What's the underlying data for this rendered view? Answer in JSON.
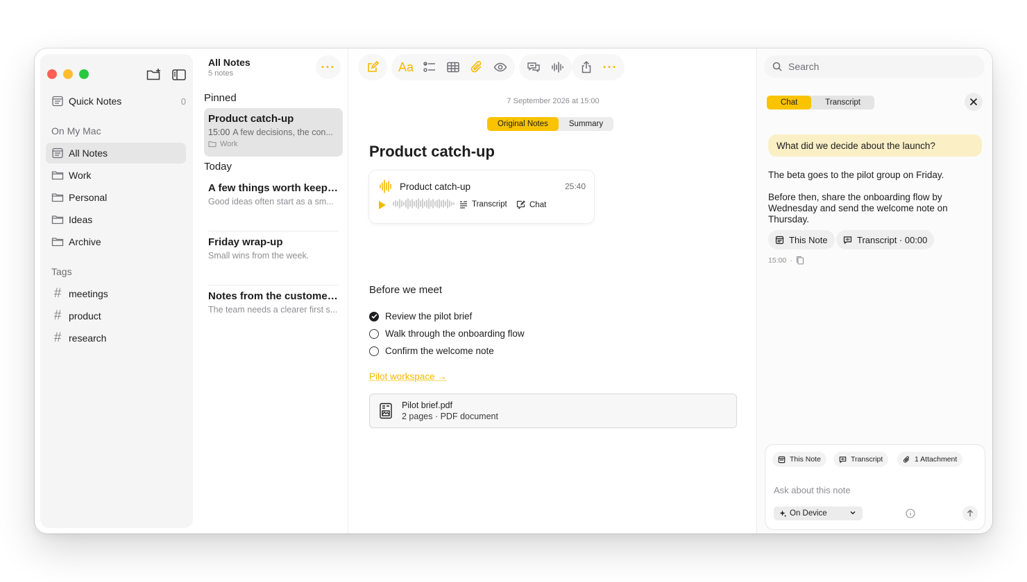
{
  "sidebar": {
    "quick_notes": {
      "label": "Quick Notes",
      "count": "0"
    },
    "section_on_my_mac": "On My Mac",
    "folders": [
      {
        "label": "All Notes",
        "icon": "notes-icon",
        "active": true
      },
      {
        "label": "Work",
        "icon": "folder-icon"
      },
      {
        "label": "Personal",
        "icon": "folder-icon"
      },
      {
        "label": "Ideas",
        "icon": "folder-icon"
      },
      {
        "label": "Archive",
        "icon": "folder-icon"
      }
    ],
    "section_tags": "Tags",
    "tags": [
      "meetings",
      "product",
      "research"
    ]
  },
  "list": {
    "title": "All Notes",
    "subtitle": "5 notes",
    "pinned_label": "Pinned",
    "today_label": "Today",
    "pinned": {
      "title": "Product catch-up",
      "time": "15:00",
      "preview": "A few decisions, the con...",
      "folder": "Work"
    },
    "today": [
      {
        "title": "A few things worth keepi...",
        "preview": "Good ideas often start as a sm..."
      },
      {
        "title": "Friday wrap-up",
        "preview": "Small wins from the week."
      },
      {
        "title": "Notes from the customer...",
        "preview": "The team needs a clearer first s..."
      }
    ]
  },
  "editor": {
    "date": "7 September 2026 at 15:00",
    "segments": [
      "Original Notes",
      "Summary"
    ],
    "title": "Product catch-up",
    "audio": {
      "title": "Product catch-up",
      "duration": "25:40",
      "transcript_label": "Transcript",
      "chat_label": "Chat"
    },
    "section": "Before we meet",
    "checklist": [
      {
        "text": "Review the pilot brief",
        "done": true
      },
      {
        "text": "Walk through the onboarding flow",
        "done": false
      },
      {
        "text": "Confirm the welcome note",
        "done": false
      }
    ],
    "link": "Pilot workspace →",
    "attachment": {
      "name": "Pilot brief.pdf",
      "meta": "2 pages · PDF document"
    }
  },
  "panel": {
    "search_placeholder": "Search",
    "tabs": [
      "Chat",
      "Transcript"
    ],
    "question": "What did we decide about the launch?",
    "answer_1": "The beta goes to the pilot group on Friday.",
    "answer_2": "Before then, share the onboarding flow by Wednesday and send the welcome note on Thursday.",
    "sources": [
      "This Note",
      "Transcript · 00:00"
    ],
    "meta_time": "15:00",
    "meta_sep": "·",
    "composer": {
      "chips": [
        "This Note",
        "Transcript",
        "1 Attachment"
      ],
      "placeholder": "Ask about this note",
      "model": "On Device"
    }
  },
  "colors": {
    "accent": "#f9c300",
    "accent_text": "#f5b800",
    "question_bg": "#faefc5"
  }
}
